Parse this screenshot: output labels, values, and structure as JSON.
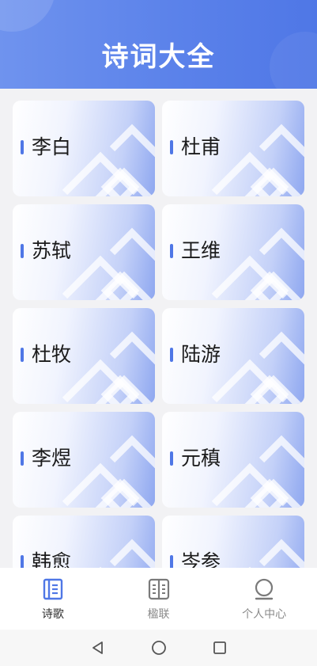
{
  "header": {
    "title": "诗词大全"
  },
  "poets": [
    {
      "name": "李白"
    },
    {
      "name": "杜甫"
    },
    {
      "name": "苏轼"
    },
    {
      "name": "王维"
    },
    {
      "name": "杜牧"
    },
    {
      "name": "陆游"
    },
    {
      "name": "李煜"
    },
    {
      "name": "元稹"
    },
    {
      "name": "韩愈"
    },
    {
      "name": "岑参"
    }
  ],
  "tabs": [
    {
      "label": "诗歌",
      "icon": "book-icon",
      "active": true
    },
    {
      "label": "楹联",
      "icon": "couplet-icon",
      "active": false
    },
    {
      "label": "个人中心",
      "icon": "user-icon",
      "active": false
    }
  ],
  "colors": {
    "accent": "#4f77e6",
    "tab_active": "#4f77e6",
    "tab_inactive": "#8a8a8a"
  }
}
